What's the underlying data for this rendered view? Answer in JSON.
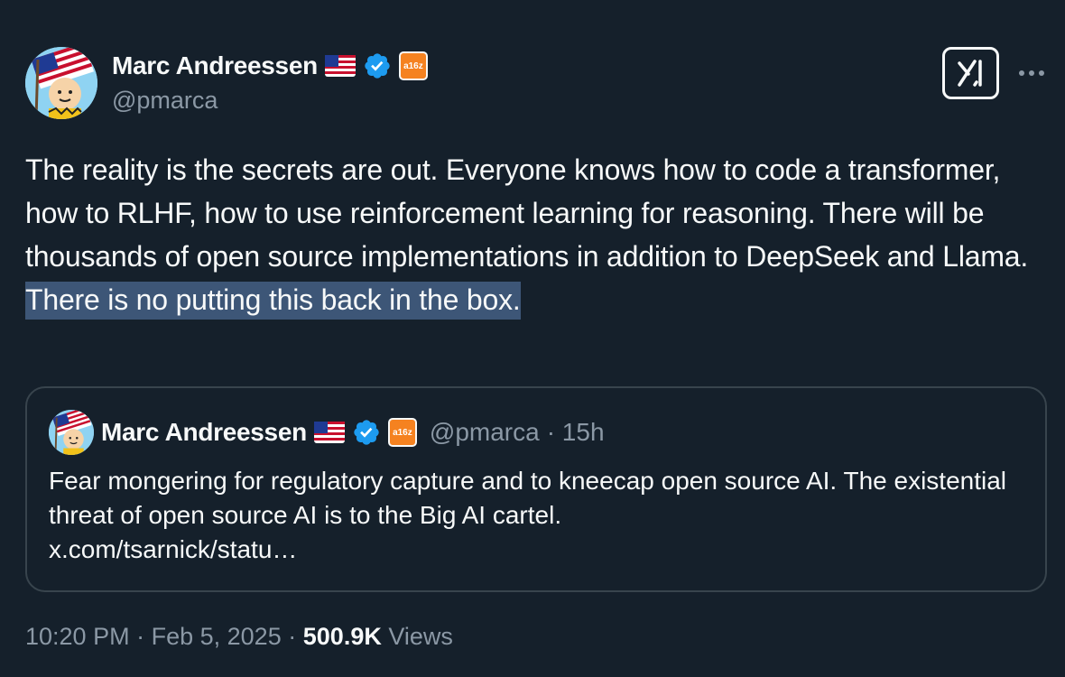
{
  "author": {
    "name": "Marc Andreessen",
    "handle": "@pmarca",
    "badge_label": "a16z"
  },
  "tweet": {
    "text_plain": "The reality is the secrets are out. Everyone knows how to code a transformer, how to RLHF, how to use reinforcement learning for reasoning. There will be thousands of open source implementations in addition to DeepSeek and Llama. ",
    "text_highlighted": "There is no putting this back in the box."
  },
  "quote": {
    "name": "Marc Andreessen",
    "handle": "@pmarca",
    "time": "· 15h",
    "badge_label": "a16z",
    "text": "Fear mongering for regulatory capture and to kneecap open source AI. The existential threat of open source AI is to the Big AI cartel.",
    "link": "x.com/tsarnick/statu…"
  },
  "footer": {
    "time": "10:20 PM",
    "date": "Feb 5, 2025",
    "separator": "·",
    "views_count": "500.9K",
    "views_label": "Views"
  },
  "icons": {
    "grok": "grok-icon",
    "more": "more-icon",
    "verified": "verified-badge-icon",
    "flag": "us-flag-icon"
  },
  "colors": {
    "background": "#15202b",
    "text": "#f7f9f9",
    "secondary": "#8b98a5",
    "verified": "#1d9bf0",
    "highlight": "#3d5677",
    "border": "#38444d",
    "a16z": "#f58220"
  }
}
